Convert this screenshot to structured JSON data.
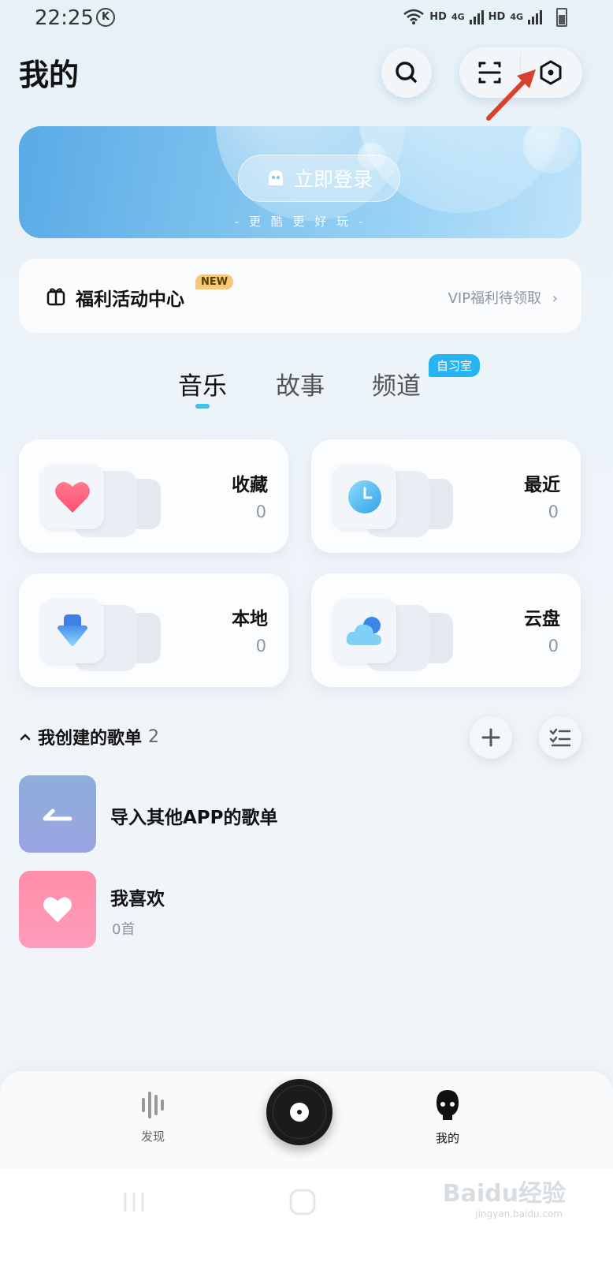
{
  "status_bar": {
    "time": "22:25",
    "k_badge": "K",
    "hd1": "HD",
    "net1": "4G",
    "hd2": "HD",
    "net2": "4G"
  },
  "header": {
    "title": "我的",
    "icons": [
      "search-icon",
      "scan-icon",
      "settings-hexagon-icon"
    ]
  },
  "login_banner": {
    "button_label": "立即登录",
    "subtitle": "- 更 酷 更 好 玩 -"
  },
  "welfare": {
    "title": "福利活动中心",
    "badge": "NEW",
    "link": "VIP福利待领取"
  },
  "tabs": [
    {
      "label": "音乐",
      "active": true
    },
    {
      "label": "故事",
      "active": false
    },
    {
      "label": "频道",
      "active": false,
      "badge": "自习室"
    }
  ],
  "cards": [
    {
      "title": "收藏",
      "count": "0",
      "icon": "heart-icon"
    },
    {
      "title": "最近",
      "count": "0",
      "icon": "clock-icon"
    },
    {
      "title": "本地",
      "count": "0",
      "icon": "download-icon"
    },
    {
      "title": "云盘",
      "count": "0",
      "icon": "cloud-icon"
    }
  ],
  "playlists": {
    "header": "我创建的歌单",
    "count": "2",
    "items": [
      {
        "name": "导入其他APP的歌单",
        "sub": ""
      },
      {
        "name": "我喜欢",
        "sub": "0首"
      }
    ]
  },
  "bottom_nav": {
    "items": [
      {
        "label": "发现",
        "active": false
      },
      {
        "label": "我的",
        "active": true
      }
    ]
  },
  "watermark": {
    "text": "Baidu经验",
    "url": "jingyan.baidu.com"
  },
  "colors": {
    "accent": "#3cc2e8",
    "badge_blue": "#26b5f0",
    "new_badge": "#f4c97b",
    "arrow": "#d8412f"
  }
}
